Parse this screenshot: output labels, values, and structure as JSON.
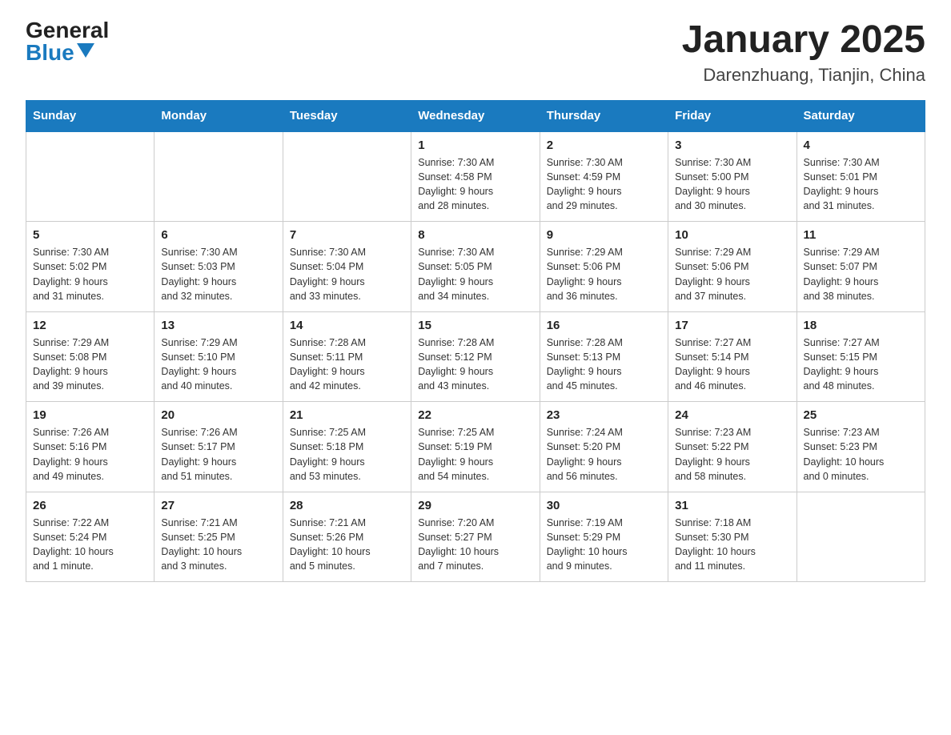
{
  "logo": {
    "general": "General",
    "blue": "Blue",
    "triangle_color": "#1a7abf"
  },
  "title": "January 2025",
  "subtitle": "Darenzhuang, Tianjin, China",
  "header_color": "#1a7abf",
  "days_of_week": [
    "Sunday",
    "Monday",
    "Tuesday",
    "Wednesday",
    "Thursday",
    "Friday",
    "Saturday"
  ],
  "weeks": [
    [
      {
        "day": "",
        "info": ""
      },
      {
        "day": "",
        "info": ""
      },
      {
        "day": "",
        "info": ""
      },
      {
        "day": "1",
        "info": "Sunrise: 7:30 AM\nSunset: 4:58 PM\nDaylight: 9 hours\nand 28 minutes."
      },
      {
        "day": "2",
        "info": "Sunrise: 7:30 AM\nSunset: 4:59 PM\nDaylight: 9 hours\nand 29 minutes."
      },
      {
        "day": "3",
        "info": "Sunrise: 7:30 AM\nSunset: 5:00 PM\nDaylight: 9 hours\nand 30 minutes."
      },
      {
        "day": "4",
        "info": "Sunrise: 7:30 AM\nSunset: 5:01 PM\nDaylight: 9 hours\nand 31 minutes."
      }
    ],
    [
      {
        "day": "5",
        "info": "Sunrise: 7:30 AM\nSunset: 5:02 PM\nDaylight: 9 hours\nand 31 minutes."
      },
      {
        "day": "6",
        "info": "Sunrise: 7:30 AM\nSunset: 5:03 PM\nDaylight: 9 hours\nand 32 minutes."
      },
      {
        "day": "7",
        "info": "Sunrise: 7:30 AM\nSunset: 5:04 PM\nDaylight: 9 hours\nand 33 minutes."
      },
      {
        "day": "8",
        "info": "Sunrise: 7:30 AM\nSunset: 5:05 PM\nDaylight: 9 hours\nand 34 minutes."
      },
      {
        "day": "9",
        "info": "Sunrise: 7:29 AM\nSunset: 5:06 PM\nDaylight: 9 hours\nand 36 minutes."
      },
      {
        "day": "10",
        "info": "Sunrise: 7:29 AM\nSunset: 5:06 PM\nDaylight: 9 hours\nand 37 minutes."
      },
      {
        "day": "11",
        "info": "Sunrise: 7:29 AM\nSunset: 5:07 PM\nDaylight: 9 hours\nand 38 minutes."
      }
    ],
    [
      {
        "day": "12",
        "info": "Sunrise: 7:29 AM\nSunset: 5:08 PM\nDaylight: 9 hours\nand 39 minutes."
      },
      {
        "day": "13",
        "info": "Sunrise: 7:29 AM\nSunset: 5:10 PM\nDaylight: 9 hours\nand 40 minutes."
      },
      {
        "day": "14",
        "info": "Sunrise: 7:28 AM\nSunset: 5:11 PM\nDaylight: 9 hours\nand 42 minutes."
      },
      {
        "day": "15",
        "info": "Sunrise: 7:28 AM\nSunset: 5:12 PM\nDaylight: 9 hours\nand 43 minutes."
      },
      {
        "day": "16",
        "info": "Sunrise: 7:28 AM\nSunset: 5:13 PM\nDaylight: 9 hours\nand 45 minutes."
      },
      {
        "day": "17",
        "info": "Sunrise: 7:27 AM\nSunset: 5:14 PM\nDaylight: 9 hours\nand 46 minutes."
      },
      {
        "day": "18",
        "info": "Sunrise: 7:27 AM\nSunset: 5:15 PM\nDaylight: 9 hours\nand 48 minutes."
      }
    ],
    [
      {
        "day": "19",
        "info": "Sunrise: 7:26 AM\nSunset: 5:16 PM\nDaylight: 9 hours\nand 49 minutes."
      },
      {
        "day": "20",
        "info": "Sunrise: 7:26 AM\nSunset: 5:17 PM\nDaylight: 9 hours\nand 51 minutes."
      },
      {
        "day": "21",
        "info": "Sunrise: 7:25 AM\nSunset: 5:18 PM\nDaylight: 9 hours\nand 53 minutes."
      },
      {
        "day": "22",
        "info": "Sunrise: 7:25 AM\nSunset: 5:19 PM\nDaylight: 9 hours\nand 54 minutes."
      },
      {
        "day": "23",
        "info": "Sunrise: 7:24 AM\nSunset: 5:20 PM\nDaylight: 9 hours\nand 56 minutes."
      },
      {
        "day": "24",
        "info": "Sunrise: 7:23 AM\nSunset: 5:22 PM\nDaylight: 9 hours\nand 58 minutes."
      },
      {
        "day": "25",
        "info": "Sunrise: 7:23 AM\nSunset: 5:23 PM\nDaylight: 10 hours\nand 0 minutes."
      }
    ],
    [
      {
        "day": "26",
        "info": "Sunrise: 7:22 AM\nSunset: 5:24 PM\nDaylight: 10 hours\nand 1 minute."
      },
      {
        "day": "27",
        "info": "Sunrise: 7:21 AM\nSunset: 5:25 PM\nDaylight: 10 hours\nand 3 minutes."
      },
      {
        "day": "28",
        "info": "Sunrise: 7:21 AM\nSunset: 5:26 PM\nDaylight: 10 hours\nand 5 minutes."
      },
      {
        "day": "29",
        "info": "Sunrise: 7:20 AM\nSunset: 5:27 PM\nDaylight: 10 hours\nand 7 minutes."
      },
      {
        "day": "30",
        "info": "Sunrise: 7:19 AM\nSunset: 5:29 PM\nDaylight: 10 hours\nand 9 minutes."
      },
      {
        "day": "31",
        "info": "Sunrise: 7:18 AM\nSunset: 5:30 PM\nDaylight: 10 hours\nand 11 minutes."
      },
      {
        "day": "",
        "info": ""
      }
    ]
  ]
}
